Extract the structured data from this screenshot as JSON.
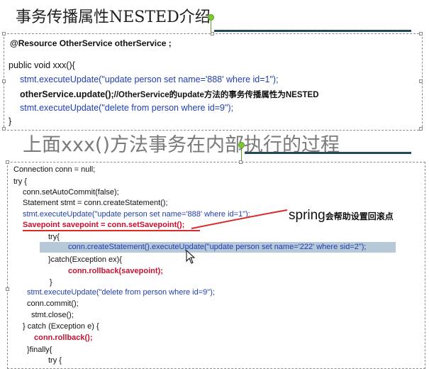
{
  "slide1": {
    "title": "事务传播属性NESTED介绍",
    "lines": {
      "annotation": "@Resource  OtherService otherService ;",
      "method": "public void xxx(){",
      "update1": "stmt.executeUpdate(\"update person set name='888' where id=1\");",
      "other_prefix": "otherService.update();",
      "other_comment": "//OtherService的update方法的事务传播属性为NESTED",
      "delete": "stmt.executeUpdate(\"delete from person where id=9\");",
      "close": "}"
    }
  },
  "slide2": {
    "title": "上面xxx()方法事务在内部执行的过程",
    "annotation_big": "spring",
    "annotation_small": "会帮助设置回滚点",
    "code": [
      "Connection conn = null;",
      "try {",
      "conn.setAutoCommit(false);",
      "Statement stmt = conn.createStatement();",
      "stmt.executeUpdate(\"update person set name='888' where id=1\");",
      "Savepoint savepoint = conn.setSavepoint();",
      "try{",
      "conn.createStatement().executeUpdate(\"update person set name='222' where sid=2\");",
      "}catch(Exception ex){",
      "conn.rollback(savepoint);",
      "}",
      "stmt.executeUpdate(\"delete from person where id=9\");",
      "conn.commit();",
      "stmt.close();",
      "} catch (Exception e) {",
      "conn.rollback();",
      "}finally{",
      "try {"
    ]
  },
  "colors": {
    "code_blue": "#1f3fb0",
    "code_red": "#c8102e",
    "rule": "#1f4a5a",
    "highlight": "#b7c8d9",
    "rotate_handle": "#7ec832"
  }
}
